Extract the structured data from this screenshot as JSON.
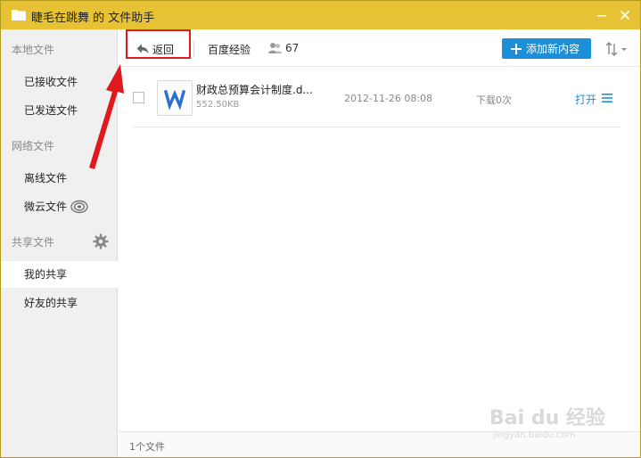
{
  "window": {
    "title": "睫毛在跳舞 的 文件助手"
  },
  "sidebar": {
    "local_section": "本地文件",
    "received": "已接收文件",
    "sent": "已发送文件",
    "network_section": "网络文件",
    "offline": "离线文件",
    "weiyun": "微云文件",
    "shared_section": "共享文件",
    "my_share": "我的共享",
    "friends_share": "好友的共享"
  },
  "toolbar": {
    "back_label": "返回",
    "owner": "百度经验",
    "member_count": "67",
    "add_label": "添加新内容"
  },
  "files": [
    {
      "name": "财政总预算会计制度.d...",
      "size": "552.50KB",
      "date": "2012-11-26 08:08",
      "downloads": "下载0次",
      "open_label": "打开"
    }
  ],
  "status": {
    "count": "1个文件"
  },
  "watermark": {
    "brand": "Bai du 经验",
    "url": "jingyan.baidu.com"
  },
  "colors": {
    "titlebar": "#e6c234",
    "accent": "#1d8fd8",
    "annotation": "#e0191e"
  }
}
